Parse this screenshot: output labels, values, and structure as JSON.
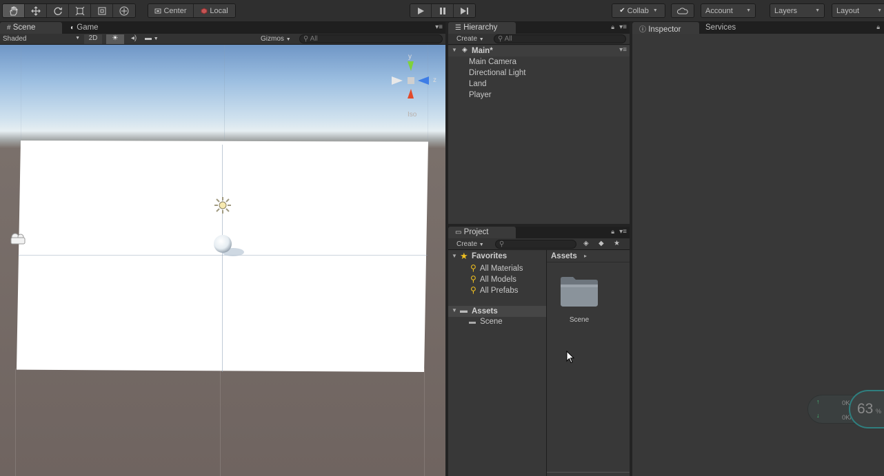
{
  "toolbar": {
    "tools": [
      "hand-tool",
      "move-tool",
      "rotate-tool",
      "scale-tool",
      "rect-tool",
      "transform-tool"
    ],
    "pivot_mode": "Center",
    "pivot_rotation": "Local",
    "collab": "Collab",
    "account": "Account",
    "layers": "Layers",
    "layout": "Layout"
  },
  "scene_panel": {
    "tab_scene": "Scene",
    "tab_game": "Game",
    "shading_mode": "Shaded",
    "mode_2d": "2D",
    "gizmos": "Gizmos",
    "search_placeholder": "All",
    "gizmo_axes": {
      "y": "y",
      "z": "z"
    },
    "projection": "Iso"
  },
  "hierarchy": {
    "tab": "Hierarchy",
    "create": "Create",
    "search_placeholder": "All",
    "scene_name": "Main*",
    "items": [
      "Main Camera",
      "Directional Light",
      "Land",
      "Player"
    ]
  },
  "project": {
    "tab": "Project",
    "create": "Create",
    "favorites_label": "Favorites",
    "favorites": [
      "All Materials",
      "All Models",
      "All Prefabs"
    ],
    "assets_label": "Assets",
    "asset_folders": [
      "Scene"
    ],
    "breadcrumb": "Assets",
    "grid_items": [
      "Scene"
    ]
  },
  "inspector": {
    "tab_inspector": "Inspector",
    "tab_services": "Services"
  },
  "network_widget": {
    "upload": "0K/s",
    "download": "0K/s",
    "percent": "63",
    "percent_sign": "%"
  }
}
